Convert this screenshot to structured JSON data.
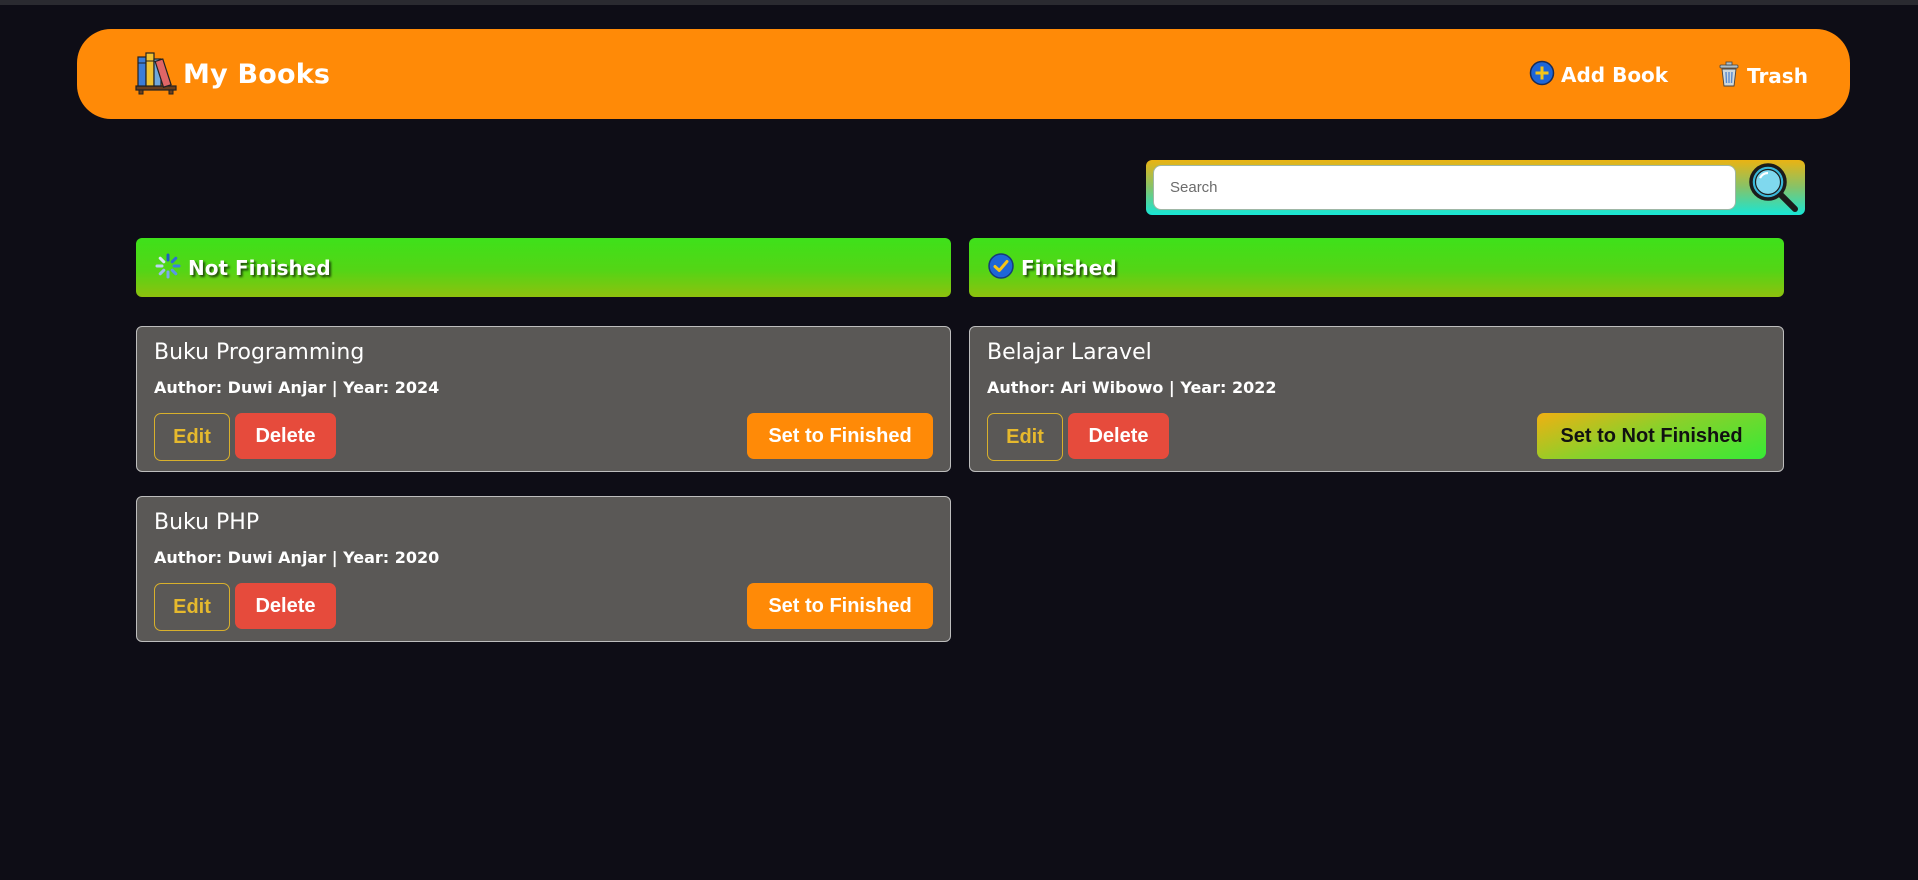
{
  "header": {
    "title": "My Books",
    "add_book_label": "Add Book",
    "trash_label": "Trash"
  },
  "search": {
    "placeholder": "Search"
  },
  "sections": {
    "not_finished_title": "Not Finished",
    "finished_title": "Finished"
  },
  "books_not_finished": [
    {
      "title": "Buku Programming",
      "meta": "Author: Duwi Anjar | Year: 2024",
      "edit": "Edit",
      "delete": "Delete",
      "toggle": "Set to Finished"
    },
    {
      "title": "Buku PHP",
      "meta": "Author: Duwi Anjar | Year: 2020",
      "edit": "Edit",
      "delete": "Delete",
      "toggle": "Set to Finished"
    }
  ],
  "books_finished": [
    {
      "title": "Belajar Laravel",
      "meta": "Author: Ari Wibowo | Year: 2022",
      "edit": "Edit",
      "delete": "Delete",
      "toggle": "Set to Not Finished"
    }
  ],
  "icons": {
    "brand": "bookshelf-icon",
    "add": "plus-circle-icon",
    "trash": "trash-icon",
    "search": "magnifier-icon",
    "not_finished": "loading-spinner-icon",
    "finished": "check-circle-icon"
  },
  "colors": {
    "background": "#0e0d16",
    "navbar": "#ff8a07",
    "section_header": "#54d516",
    "card": "#5a5856",
    "edit": "#e6b92d",
    "delete": "#e64b3c",
    "finish_button": "#ff8a07"
  }
}
